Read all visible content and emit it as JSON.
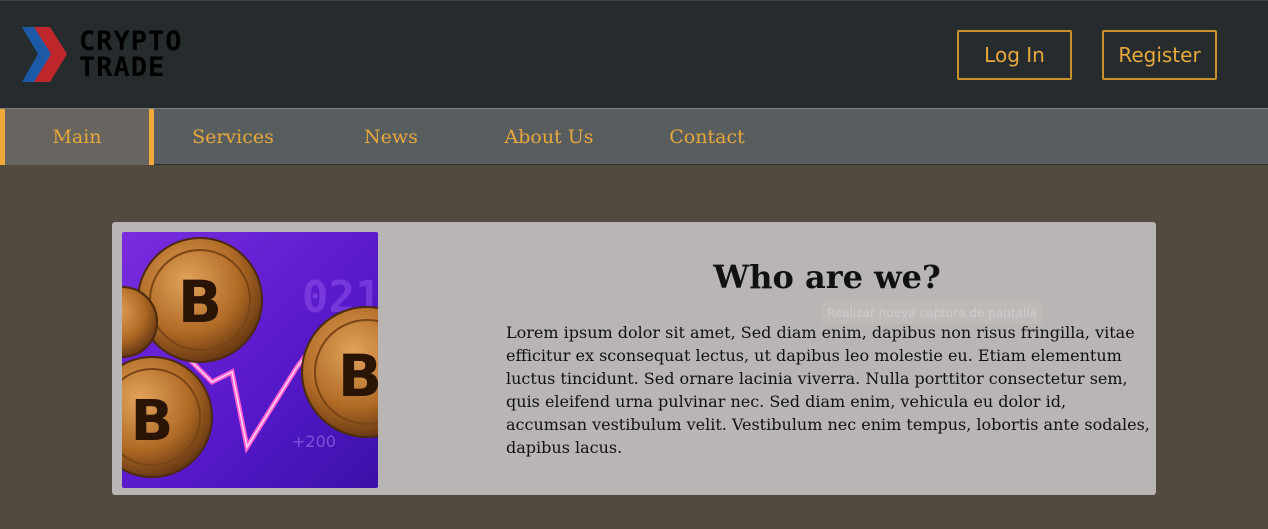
{
  "logo": {
    "line1": "CRYPTO",
    "line2": "TRADE",
    "colors": {
      "red": "#c0272d",
      "blue": "#1c5aa8"
    }
  },
  "header": {
    "login_label": "Log In",
    "register_label": "Register",
    "accent": "#c9932c"
  },
  "nav": {
    "items": [
      {
        "label": "Main",
        "active": true
      },
      {
        "label": "Services"
      },
      {
        "label": "News"
      },
      {
        "label": "About Us"
      },
      {
        "label": "Contact"
      }
    ]
  },
  "about": {
    "title": "Who are we?",
    "body": "Lorem ipsum dolor sit amet, Sed diam enim, dapibus non risus fringilla, vitae efficitur ex sconsequat lectus, ut dapibus leo molestie eu. Etiam elementum luctus tincidunt. Sed ornare lacinia viverra. Nulla porttitor consectetur sem, quis eleifend urna pulvinar nec. Sed diam enim, vehicula eu dolor id, accumsan vestibulum velit. Vestibulum nec enim tempus, lobortis ante sodales, dapibus lacus.",
    "image_icon": "bitcoin-coins-image",
    "tooltip": "Realizar nueva captura de pantalla"
  }
}
